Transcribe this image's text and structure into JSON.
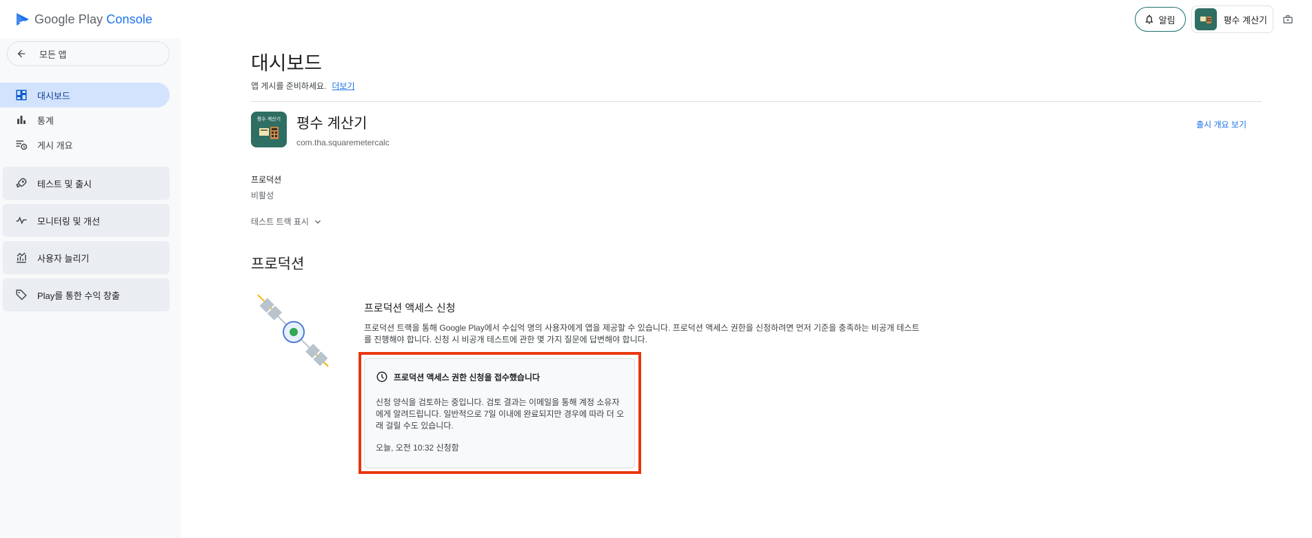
{
  "header": {
    "logo_google_play": "Google Play",
    "logo_console": "Console",
    "notifications_label": "알림",
    "account_app_name": "평수 계산기"
  },
  "sidebar": {
    "back_label": "모든 앱",
    "items": [
      {
        "label": "대시보드",
        "icon": "dashboard-icon",
        "active": true
      },
      {
        "label": "통계",
        "icon": "bar-chart-icon",
        "active": false
      },
      {
        "label": "게시 개요",
        "icon": "publishing-overview-icon",
        "active": false
      }
    ],
    "groups": [
      {
        "label": "테스트 및 출시",
        "icon": "rocket-icon"
      },
      {
        "label": "모니터링 및 개선",
        "icon": "vitals-icon"
      },
      {
        "label": "사용자 늘리기",
        "icon": "grow-users-icon"
      },
      {
        "label": "Play를 통한 수익 창출",
        "icon": "tag-icon"
      }
    ]
  },
  "main": {
    "title": "대시보드",
    "subtitle": "앱 게시를 준비하세요.",
    "more_link": "더보기",
    "app": {
      "name": "평수 계산기",
      "package": "com.tha.squaremetercalc",
      "icon_text": "평수 계산기"
    },
    "release_overview_link": "출시 개요 보기",
    "production_label": "프로덕션",
    "production_status": "비활성",
    "show_test_tracks": "테스트 트랙 표시",
    "section_title": "프로덕션",
    "access_request": {
      "title": "프로덕션 액세스 신청",
      "description": "프로덕션 트랙을 통해 Google Play에서 수십억 명의 사용자에게 앱을 제공할 수 있습니다. 프로덕션 액세스 권한을 신청하려면 먼저 기준을 충족하는 비공개 테스트를 진행해야 합니다. 신청 시 비공개 테스트에 관한 몇 가지 질문에 답변해야 합니다.",
      "notice_title": "프로덕션 액세스 권한 신청을 접수했습니다",
      "notice_body": "신청 양식을 검토하는 중입니다. 검토 결과는 이메일을 통해 계정 소유자에게 알려드립니다. 일반적으로 7일 이내에 완료되지만 경우에 따라 더 오래 걸릴 수도 있습니다.",
      "notice_time": "오늘, 오전 10:32 신청함"
    }
  },
  "colors": {
    "accent": "#1a73e8",
    "active_nav_bg": "#d3e3fd",
    "app_icon_bg": "#2f6e63",
    "highlight_border": "#e8360f"
  }
}
